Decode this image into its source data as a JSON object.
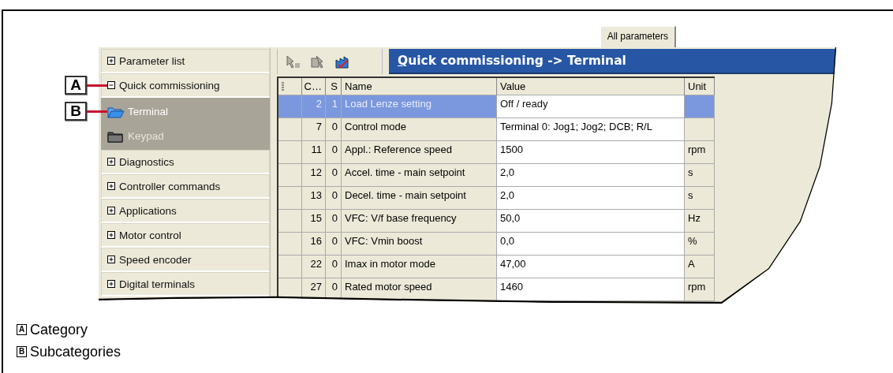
{
  "tab": {
    "label": "All parameters",
    "selected": true
  },
  "sidebar": {
    "items": [
      {
        "label": "Parameter list",
        "expanded": false
      },
      {
        "label": "Quick commissioning",
        "expanded": true,
        "children": [
          {
            "label": "Terminal",
            "selected": true
          },
          {
            "label": "Keypad",
            "selected": false
          }
        ]
      },
      {
        "label": "Diagnostics",
        "expanded": false
      },
      {
        "label": "Controller commands",
        "expanded": false
      },
      {
        "label": "Applications",
        "expanded": false
      },
      {
        "label": "Motor control",
        "expanded": false
      },
      {
        "label": "Speed encoder",
        "expanded": false
      },
      {
        "label": "Digital terminals",
        "expanded": false
      }
    ]
  },
  "toolbar": [
    {
      "disabled": true
    },
    {
      "disabled": true
    },
    {
      "disabled": false
    }
  ],
  "header": {
    "title": "Quick commissioning -> Terminal"
  },
  "table": {
    "columns": [
      "C…",
      "S",
      "Name",
      "Value",
      "Unit"
    ],
    "rows": [
      {
        "code": "2",
        "s": "1",
        "name": "Load Lenze setting",
        "value": "Off / ready",
        "unit": "",
        "selected": true
      },
      {
        "code": "7",
        "s": "0",
        "name": "Control mode",
        "value": "Terminal  0: Jog1; Jog2; DCB; R/L",
        "unit": "",
        "selected": false
      },
      {
        "code": "11",
        "s": "0",
        "name": "Appl.: Reference speed",
        "value": "1500",
        "unit": "rpm",
        "selected": false
      },
      {
        "code": "12",
        "s": "0",
        "name": "Accel. time - main setpoint",
        "value": "2,0",
        "unit": "s",
        "selected": false
      },
      {
        "code": "13",
        "s": "0",
        "name": "Decel. time - main setpoint",
        "value": "2,0",
        "unit": "s",
        "selected": false
      },
      {
        "code": "15",
        "s": "0",
        "name": "VFC: V/f base frequency",
        "value": "50,0",
        "unit": "Hz",
        "selected": false
      },
      {
        "code": "16",
        "s": "0",
        "name": "VFC: Vmin boost",
        "value": "0,0",
        "unit": "%",
        "selected": false
      },
      {
        "code": "22",
        "s": "0",
        "name": "Imax in motor mode",
        "value": "47,00",
        "unit": "A",
        "selected": false
      },
      {
        "code": "27",
        "s": "0",
        "name": "Rated motor speed",
        "value": "1460",
        "unit": "rpm",
        "selected": false
      }
    ]
  },
  "callouts": [
    {
      "letter": "A"
    },
    {
      "letter": "B"
    }
  ],
  "legend": [
    {
      "letter": "A",
      "text": "Category"
    },
    {
      "letter": "B",
      "text": "Subcategories"
    }
  ]
}
